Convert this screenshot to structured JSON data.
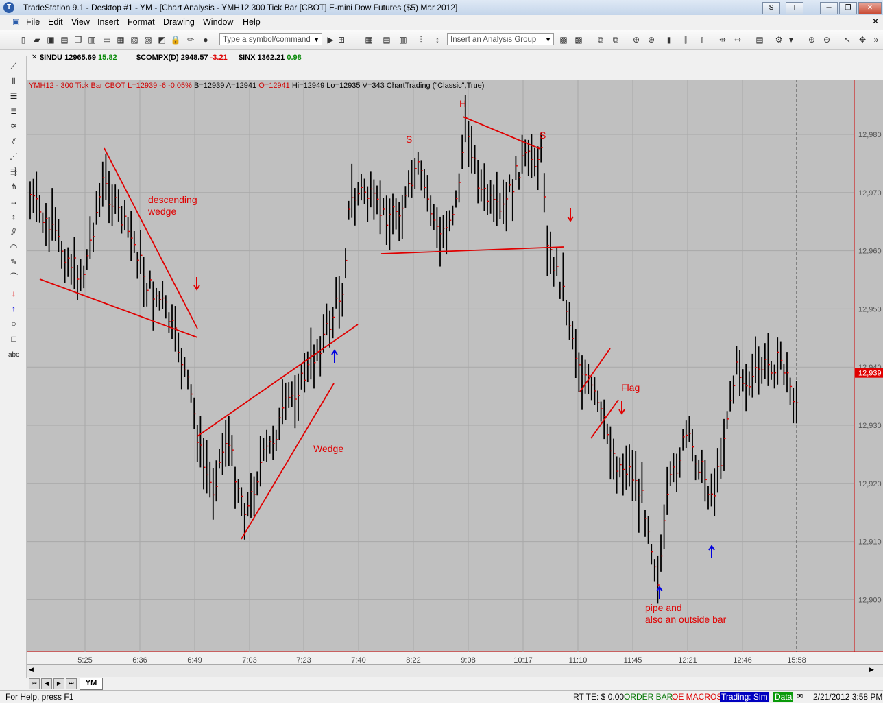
{
  "window": {
    "title": "TradeStation 9.1 - Desktop #1 - YM - [Chart Analysis - YMH12 300 Tick Bar [CBOT] E-mini Dow Futures ($5) Mar 2012]",
    "buttons": [
      "S",
      "I",
      "─",
      "❐",
      "✕"
    ]
  },
  "menu": [
    "File",
    "Edit",
    "View",
    "Insert",
    "Format",
    "Drawing",
    "Window",
    "Help"
  ],
  "toolbar": {
    "symbol_placeholder": "Type a symbol/command",
    "analysis_group": "Insert an Analysis Group"
  },
  "quotes": [
    {
      "symbol": "$INDU",
      "last": "12965.69",
      "change": "15.82",
      "dir": "up"
    },
    {
      "symbol": "$COMPX(D)",
      "last": "2948.57",
      "change": "-3.21",
      "dir": "down"
    },
    {
      "symbol": "$INX",
      "last": "1362.21",
      "change": "0.98",
      "dir": "up"
    }
  ],
  "chart_header": {
    "parts": [
      {
        "text": "YMH12 - 300 Tick Bar  CBOT  L=12939  -6  -0.05%",
        "color": "red"
      },
      {
        "text": "B=12939  A=12941",
        "color": "black"
      },
      {
        "text": "O=12941",
        "color": "red"
      },
      {
        "text": "Hi=12949  Lo=12935  V=343  ChartTrading (\"Classic\",True)",
        "color": "black"
      }
    ]
  },
  "chart_data": {
    "type": "bar",
    "title": "YMH12 - 300 Tick Bar",
    "ylim": [
      12895,
      12985
    ],
    "y_ticks": [
      "12,980",
      "12,970",
      "12,960",
      "12,950",
      "12,940",
      "12,930",
      "12,920",
      "12,910",
      "12,900"
    ],
    "x_ticks": [
      "5:25",
      "6:36",
      "6:49",
      "7:03",
      "7:23",
      "7:40",
      "8:22",
      "9:08",
      "10:17",
      "11:10",
      "11:45",
      "12:21",
      "12:46",
      "15:58"
    ],
    "last_price": "12,939",
    "annotations": [
      "descending wedge",
      "Wedge",
      "H",
      "S",
      "S",
      "Flag",
      "pipe and",
      "also an outside bar"
    ]
  },
  "tabs": {
    "active": "YM"
  },
  "status": {
    "help": "For Help, press F1",
    "rt": "RT TE: $ 0.00",
    "order_bar": "ORDER BAR",
    "macros": "OE MACROS",
    "trading": "Trading: Sim",
    "data": "Data",
    "datetime": "2/21/2012 3:58 PM"
  },
  "colors": {
    "chart_bg": "#c0c0c0",
    "bar": "#000000",
    "annotation": "#e00000",
    "arrow_up": "#0000e0"
  }
}
